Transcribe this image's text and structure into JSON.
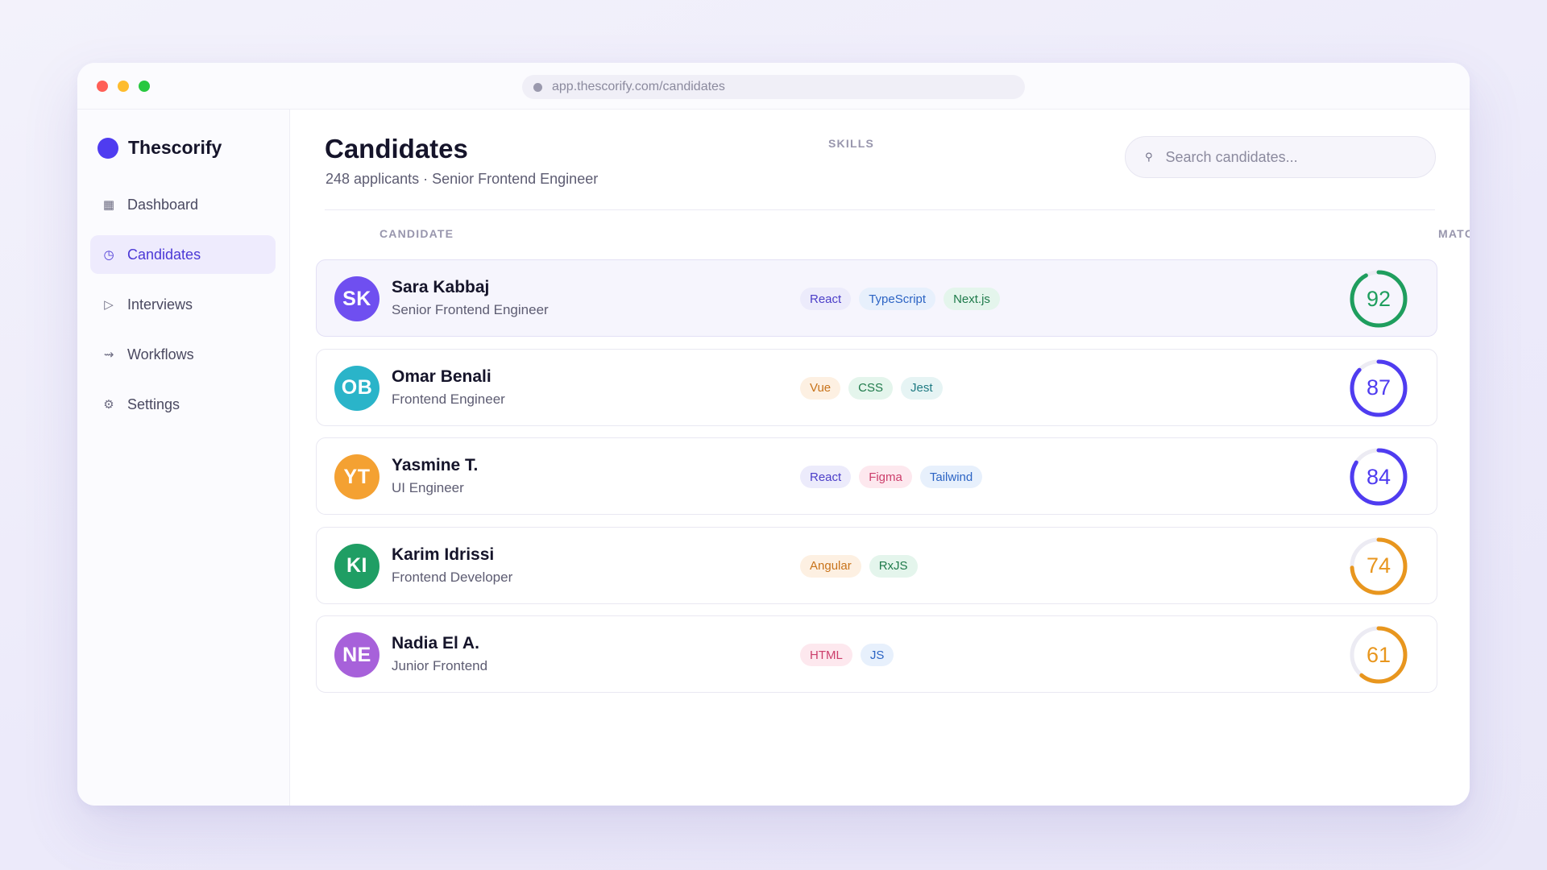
{
  "browser": {
    "url": "app.thescorify.com/candidates"
  },
  "brand": {
    "name": "Thescorify",
    "color": "#4f3cf0"
  },
  "nav": [
    {
      "label": "Dashboard",
      "icon": "grid-icon",
      "active": false
    },
    {
      "label": "Candidates",
      "icon": "clock-icon",
      "active": true
    },
    {
      "label": "Interviews",
      "icon": "play-icon",
      "active": false
    },
    {
      "label": "Workflows",
      "icon": "arrow-icon",
      "active": false
    },
    {
      "label": "Settings",
      "icon": "gear-icon",
      "active": false
    }
  ],
  "page": {
    "title": "Candidates",
    "subtitle": "248 applicants · Senior Frontend Engineer"
  },
  "search": {
    "placeholder": "Search candidates..."
  },
  "table": {
    "headers": {
      "candidate": "CANDIDATE",
      "skills": "SKILLS",
      "match": "MATCH"
    },
    "rows": [
      {
        "initials": "SK",
        "name": "Sara Kabbaj",
        "role": "Senior Frontend Engineer",
        "avatar_color": "#6f4ff0",
        "highlight": true,
        "skills": [
          {
            "label": "React",
            "bg": "#ecebfb",
            "fg": "#4b3ec8"
          },
          {
            "label": "TypeScript",
            "bg": "#e7f0fc",
            "fg": "#2c64c4"
          },
          {
            "label": "Next.js",
            "bg": "#e4f5ec",
            "fg": "#1e7a4a"
          }
        ],
        "match": 92,
        "match_color": "#1f9e5e"
      },
      {
        "initials": "OB",
        "name": "Omar Benali",
        "role": "Frontend Engineer",
        "avatar_color": "#2ab4c9",
        "highlight": false,
        "skills": [
          {
            "label": "Vue",
            "bg": "#fdf0e2",
            "fg": "#c8731a"
          },
          {
            "label": "CSS",
            "bg": "#e4f5ec",
            "fg": "#1e7a4a"
          },
          {
            "label": "Jest",
            "bg": "#e6f4f4",
            "fg": "#1f7b83"
          }
        ],
        "match": 87,
        "match_color": "#4f3cf0"
      },
      {
        "initials": "YT",
        "name": "Yasmine T.",
        "role": "UI Engineer",
        "avatar_color": "#f4a132",
        "highlight": false,
        "skills": [
          {
            "label": "React",
            "bg": "#ecebfb",
            "fg": "#4b3ec8"
          },
          {
            "label": "Figma",
            "bg": "#fde8ee",
            "fg": "#cc3e6b"
          },
          {
            "label": "Tailwind",
            "bg": "#e7f0fc",
            "fg": "#2c64c4"
          }
        ],
        "match": 84,
        "match_color": "#4f3cf0"
      },
      {
        "initials": "KI",
        "name": "Karim Idrissi",
        "role": "Frontend Developer",
        "avatar_color": "#1f9e64",
        "highlight": false,
        "skills": [
          {
            "label": "Angular",
            "bg": "#fdf0e2",
            "fg": "#c8731a"
          },
          {
            "label": "RxJS",
            "bg": "#e4f5ec",
            "fg": "#1e7a4a"
          }
        ],
        "match": 74,
        "match_color": "#e8961e"
      },
      {
        "initials": "NE",
        "name": "Nadia El A.",
        "role": "Junior Frontend",
        "avatar_color": "#a761da",
        "highlight": false,
        "skills": [
          {
            "label": "HTML",
            "bg": "#fde8ee",
            "fg": "#cc3e6b"
          },
          {
            "label": "JS",
            "bg": "#e7f0fc",
            "fg": "#2c64c4"
          }
        ],
        "match": 61,
        "match_color": "#e8961e"
      }
    ]
  }
}
